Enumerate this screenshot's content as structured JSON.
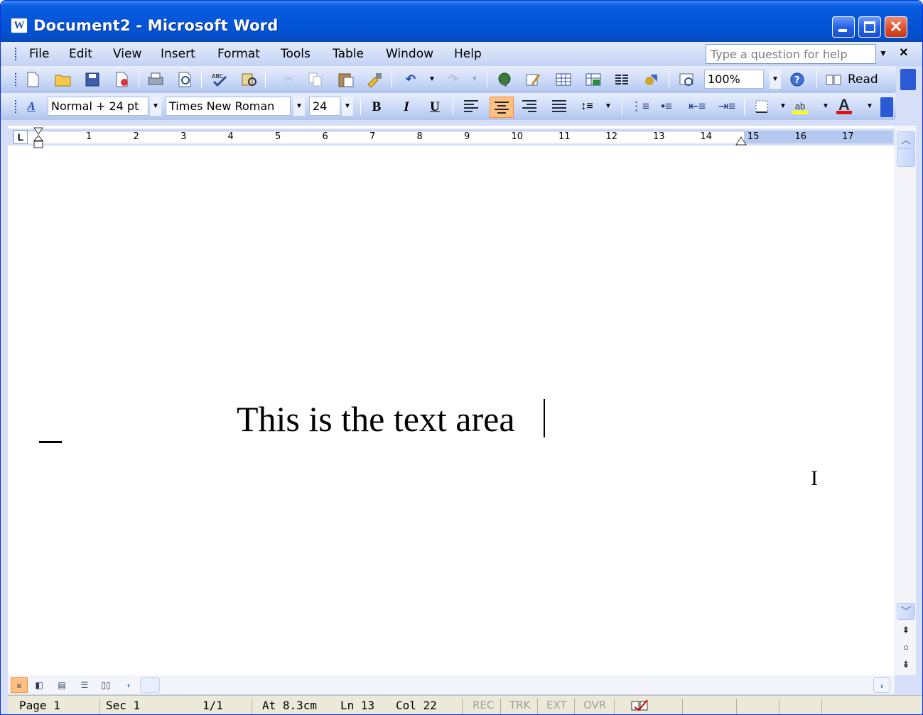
{
  "window": {
    "title": "Document2 - Microsoft Word",
    "app_icon": "W"
  },
  "menu": {
    "items": [
      "File",
      "Edit",
      "View",
      "Insert",
      "Format",
      "Tools",
      "Table",
      "Window",
      "Help"
    ],
    "help_placeholder": "Type a question for help"
  },
  "standard_toolbar": {
    "zoom": "100%",
    "read_label": "Read"
  },
  "formatting_toolbar": {
    "style": "Normal + 24 pt",
    "font": "Times New Roman",
    "size": "24",
    "bold": "B",
    "italic": "I",
    "underline": "U",
    "highlight_text": "ab",
    "font_color_text": "A",
    "active_alignment": "center"
  },
  "ruler": {
    "numbers": [
      "1",
      "2",
      "3",
      "4",
      "5",
      "6",
      "7",
      "8",
      "9",
      "10",
      "11",
      "12",
      "13",
      "14",
      "15",
      "16",
      "17"
    ]
  },
  "document": {
    "text": "This is the text area"
  },
  "status_bar": {
    "page": "Page 1",
    "sec": "Sec 1",
    "pages": "1/1",
    "at": "At 8.3cm",
    "ln": "Ln 13",
    "col": "Col 22",
    "rec": "REC",
    "trk": "TRK",
    "ext": "EXT",
    "ovr": "OVR"
  },
  "colors": {
    "titlebar": "#0454d8",
    "toolbar": "#c9d8f7",
    "active_button": "#ffc080"
  }
}
